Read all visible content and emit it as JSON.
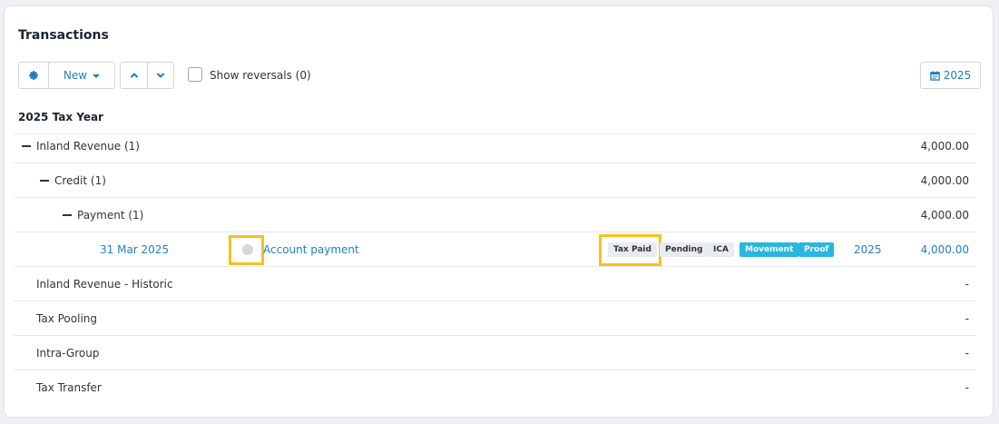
{
  "panel": {
    "title": "Transactions"
  },
  "toolbar": {
    "new_label": "New",
    "show_reversals_label": "Show reversals (0)",
    "show_reversals_checked": false,
    "year_button_label": "2025"
  },
  "table": {
    "section_header": "2025 Tax Year",
    "groups": [
      {
        "label": "Inland Revenue (1)",
        "amount": "4,000.00",
        "expanded": true
      },
      {
        "label": "Credit (1)",
        "amount": "4,000.00",
        "expanded": true
      },
      {
        "label": "Payment (1)",
        "amount": "4,000.00",
        "expanded": true
      }
    ],
    "transaction": {
      "date": "31 Mar 2025",
      "description": "Account payment",
      "tags": [
        "Tax Paid",
        "Pending",
        "ICA",
        "Movement",
        "Proof"
      ],
      "year": "2025",
      "amount": "4,000.00"
    },
    "other_groups": [
      {
        "label": "Inland Revenue - Historic",
        "amount": "-"
      },
      {
        "label": "Tax Pooling",
        "amount": "-"
      },
      {
        "label": "Intra-Group",
        "amount": "-"
      },
      {
        "label": "Tax Transfer",
        "amount": "-"
      }
    ]
  },
  "colors": {
    "accent": "#1f7fc2",
    "highlight": "#f4c21b",
    "tag_cyan": "#29b6e0"
  }
}
